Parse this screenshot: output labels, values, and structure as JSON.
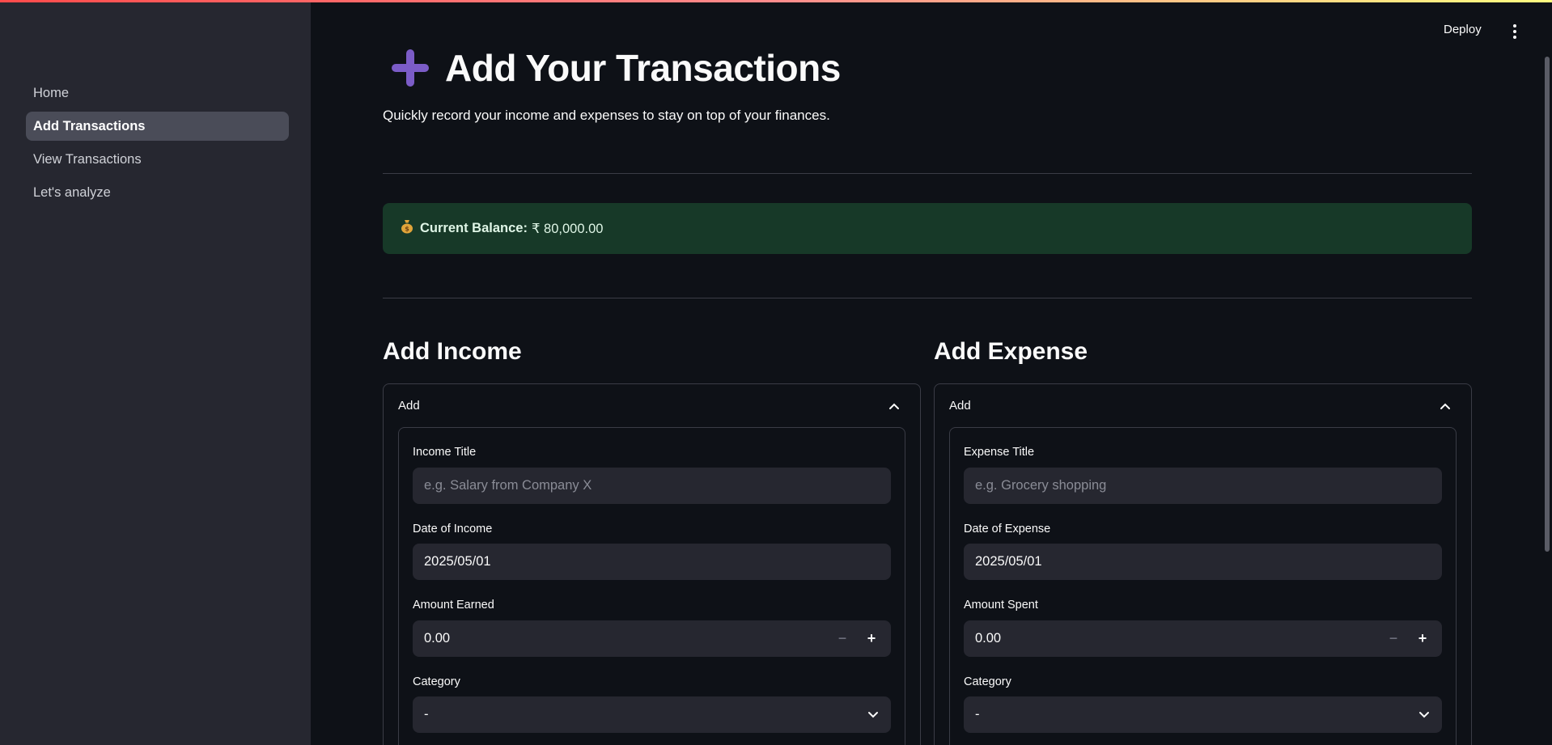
{
  "sidebar": {
    "items": [
      {
        "label": "Home",
        "active": false
      },
      {
        "label": "Add Transactions",
        "active": true
      },
      {
        "label": "View Transactions",
        "active": false
      },
      {
        "label": "Let's analyze",
        "active": false
      }
    ]
  },
  "header": {
    "deploy_label": "Deploy",
    "menu_icon": "kebab-menu-icon"
  },
  "page": {
    "title": "Add Your Transactions",
    "title_icon": "plus-icon",
    "subtitle": "Quickly record your income and expenses to stay on top of your finances."
  },
  "balance": {
    "icon": "money-bag-icon",
    "label": "Current Balance:",
    "value": "₹ 80,000.00"
  },
  "income": {
    "section_title": "Add Income",
    "expander_label": "Add",
    "title_label": "Income Title",
    "title_placeholder": "e.g. Salary from Company X",
    "date_label": "Date of Income",
    "date_value": "2025/05/01",
    "amount_label": "Amount Earned",
    "amount_value": "0.00",
    "category_label": "Category",
    "category_value": "-"
  },
  "expense": {
    "section_title": "Add Expense",
    "expander_label": "Add",
    "title_label": "Expense Title",
    "title_placeholder": "e.g. Grocery shopping",
    "date_label": "Date of Expense",
    "date_value": "2025/05/01",
    "amount_label": "Amount Spent",
    "amount_value": "0.00",
    "category_label": "Category",
    "category_value": "-"
  },
  "stepper": {
    "minus": "−",
    "plus": "+"
  },
  "colors": {
    "accent_purple": "#7b5cc7",
    "balance_bg": "#173928",
    "sidebar_bg": "#262730",
    "main_bg": "#0e1117"
  }
}
